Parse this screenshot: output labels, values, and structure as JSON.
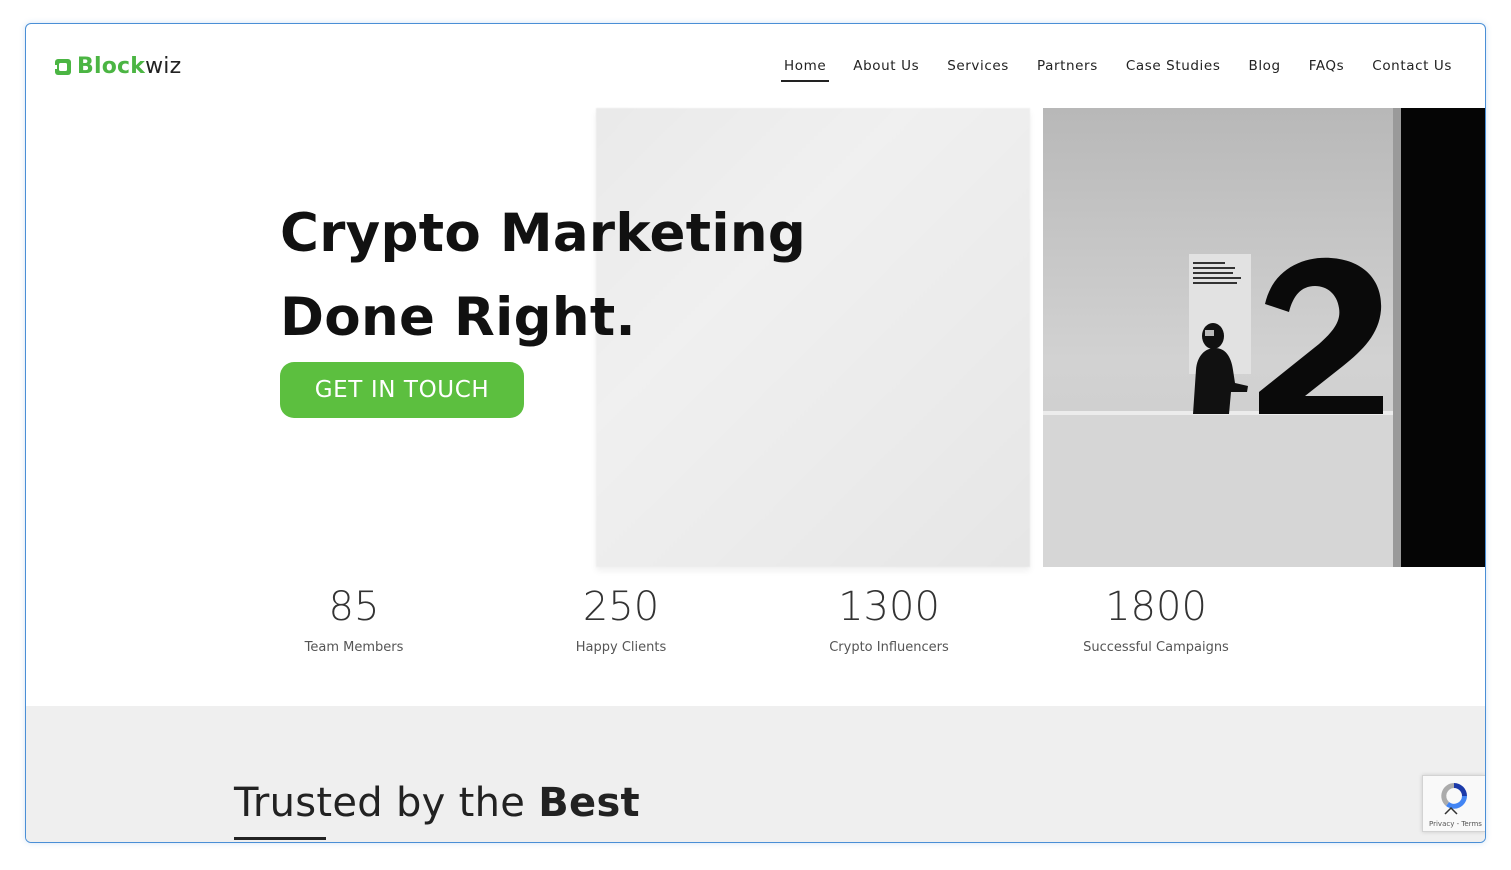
{
  "brand": {
    "part1": "Block",
    "part2": "wiz",
    "accent": "#4bb543"
  },
  "nav": {
    "items": [
      {
        "label": "Home",
        "active": true
      },
      {
        "label": "About Us"
      },
      {
        "label": "Services"
      },
      {
        "label": "Partners"
      },
      {
        "label": "Case Studies"
      },
      {
        "label": "Blog"
      },
      {
        "label": "FAQs"
      },
      {
        "label": "Contact Us"
      }
    ]
  },
  "hero": {
    "line1": "Crypto Marketing",
    "line2": "Done Right.",
    "cta": "GET IN TOUCH",
    "cta_color": "#5cbf3f"
  },
  "stats": [
    {
      "value": "85",
      "label": "Team Members"
    },
    {
      "value": "250",
      "label": "Happy Clients"
    },
    {
      "value": "1300",
      "label": "Crypto Influencers"
    },
    {
      "value": "1800",
      "label": "Successful Campaigns"
    }
  ],
  "trusted": {
    "prefix": "Trusted by the ",
    "bold": "Best"
  },
  "recaptcha": {
    "text": "Privacy - Terms",
    "icon": "recaptcha-icon"
  },
  "scroll_top": {
    "icon": "chevron-up-icon"
  }
}
